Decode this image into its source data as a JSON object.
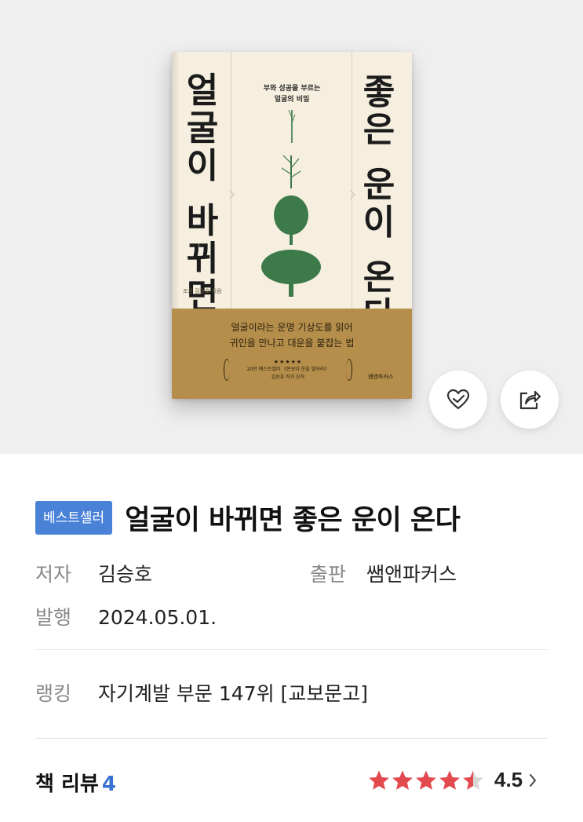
{
  "cover": {
    "title_left": [
      "얼",
      "굴",
      "이",
      "바",
      "뀌",
      "면"
    ],
    "title_right": [
      "좋",
      "은",
      "운",
      "이",
      "온",
      "다"
    ],
    "subtitle_line1": "부와 성공을 부르는",
    "subtitle_line2": "얼굴의 비밀",
    "author_small": "조운 김승호 지음",
    "band_line1": "얼굴이라는 운명 기상도를 읽어",
    "band_line2": "귀인을 만나고 대운을 붙잡는 법",
    "band_stars": "★★★★★",
    "band_promo1": "20만 베스트셀러 《돈보다 운을 벌어라》",
    "band_promo2": "김승호 작가 신작",
    "publisher_logo": "쌤앤파커스"
  },
  "actions": {
    "like_icon": "heart-check-icon",
    "share_icon": "share-icon"
  },
  "book": {
    "badge": "베스트셀러",
    "title": "얼굴이 바뀌면 좋은 운이 온다",
    "author_label": "저자",
    "author": "김승호",
    "publisher_label": "출판",
    "publisher": "쌤앤파커스",
    "date_label": "발행",
    "date": "2024.05.01.",
    "ranking_label": "랭킹",
    "ranking": "자기계발 부문 147위 [교보문고]"
  },
  "review": {
    "label": "책 리뷰",
    "count": "4",
    "rating": 4.5,
    "rating_text": "4.5"
  },
  "colors": {
    "badge": "#4a82d8",
    "star": "#e34a4f",
    "review_count": "#3b73d2",
    "cover_band": "#b48e4a",
    "tree": "#3d7a4a"
  }
}
